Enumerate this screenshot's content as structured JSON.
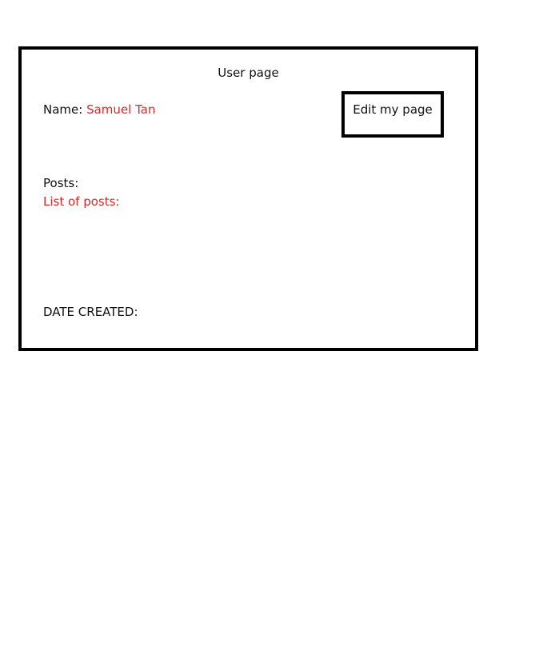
{
  "page": {
    "title": "User page"
  },
  "profile": {
    "name_label": "Name:",
    "name_value": "Samuel Tan"
  },
  "actions": {
    "edit_label": "Edit my page"
  },
  "posts": {
    "label": "Posts:",
    "list_label": "List of posts:"
  },
  "meta": {
    "date_created_label": "DATE CREATED:"
  },
  "colors": {
    "accent": "#e0282a",
    "border": "#000000",
    "text": "#111111"
  }
}
